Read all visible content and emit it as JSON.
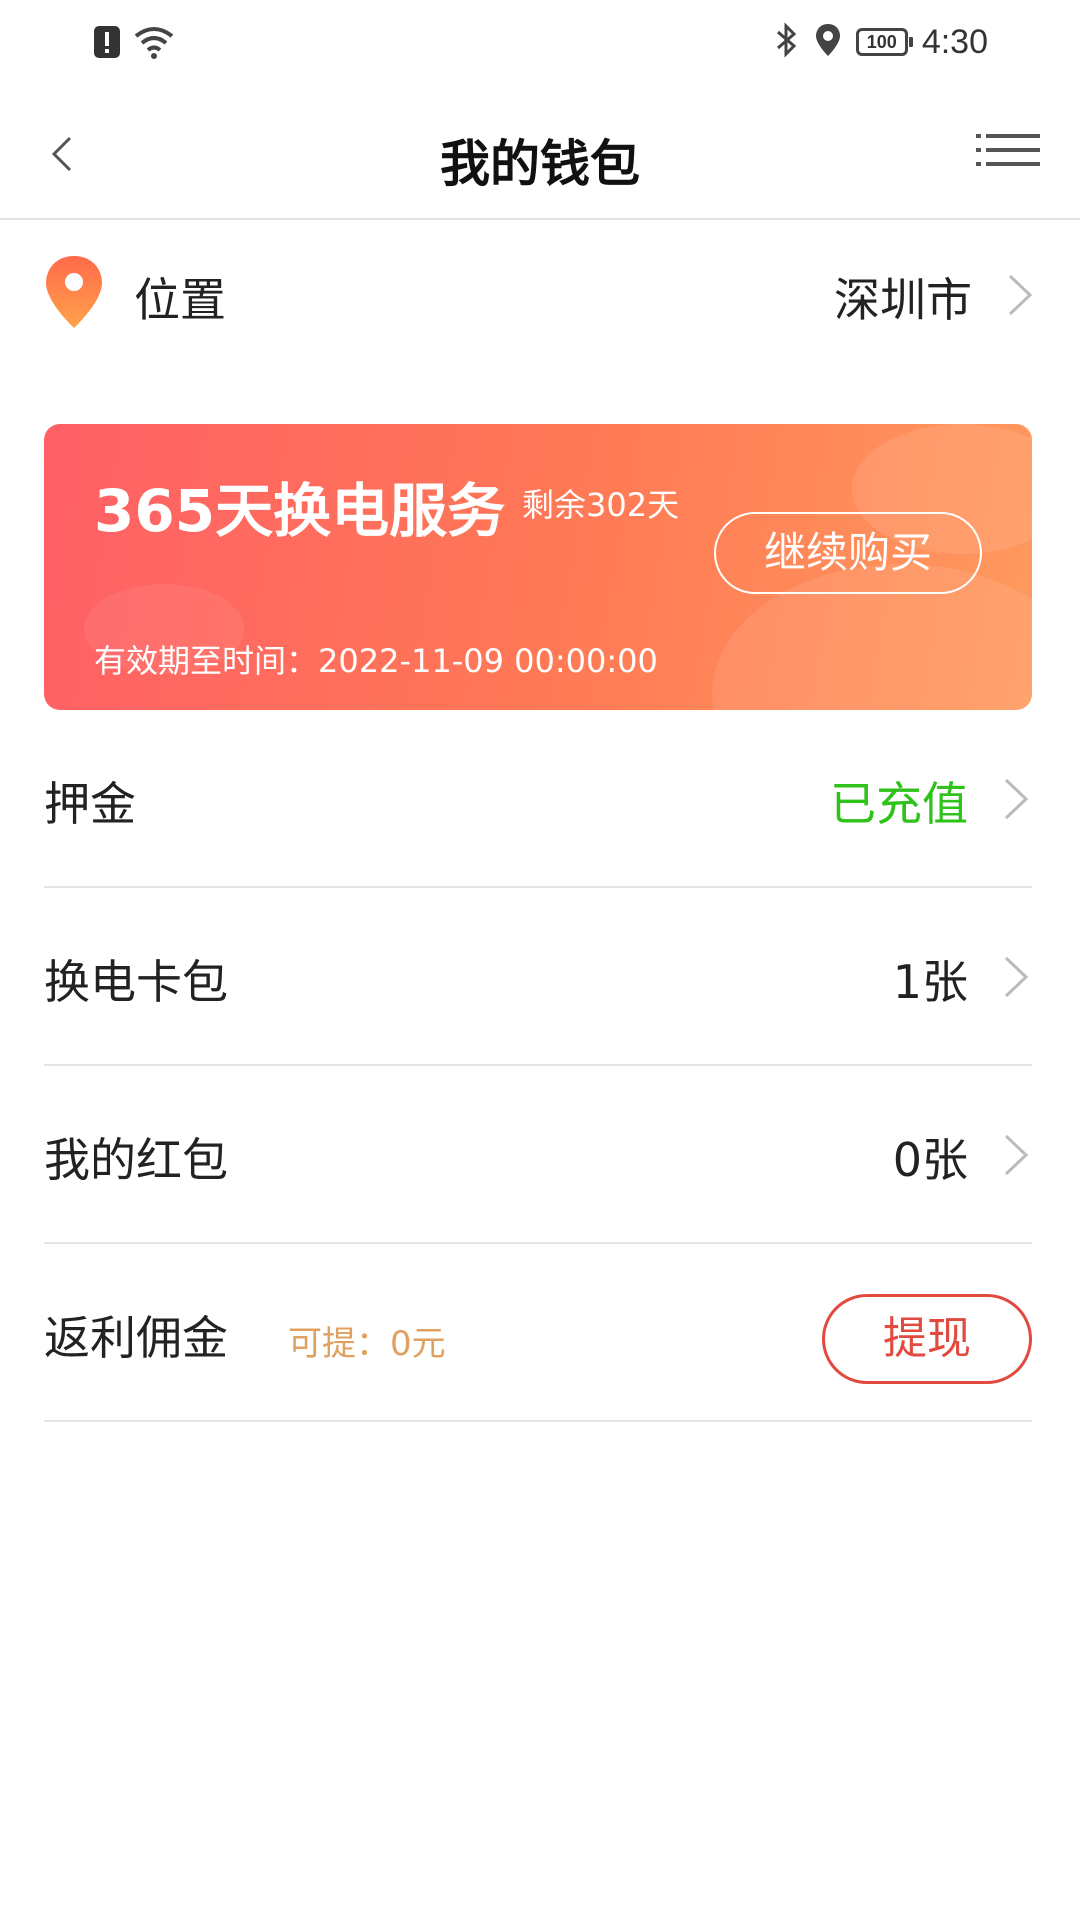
{
  "status_bar": {
    "time": "4:30",
    "battery": "100",
    "icons": [
      "alert-icon",
      "wifi-icon",
      "bluetooth-icon",
      "location-icon",
      "battery-icon"
    ]
  },
  "nav": {
    "title": "我的钱包",
    "back_icon": "chevron-left-icon",
    "menu_icon": "menu-icon"
  },
  "location": {
    "label": "位置",
    "value": "深圳市",
    "icon": "map-pin-icon"
  },
  "service_card": {
    "title": "365天换电服务",
    "remaining": "剩余302天",
    "button_label": "继续购买",
    "expiry": "有效期至时间：2022-11-09 00:00:00",
    "gradient_colors": [
      "#ff5f66",
      "#ff9a5e"
    ]
  },
  "rows": {
    "deposit": {
      "label": "押金",
      "value": "已充值",
      "value_color": "#2ec21a"
    },
    "swap_cards": {
      "label": "换电卡包",
      "value": "1张"
    },
    "red_packets": {
      "label": "我的红包",
      "value": "0张"
    },
    "commission": {
      "label": "返利佣金",
      "sub": "可提：0元",
      "button_label": "提现",
      "button_color": "#e2493f"
    }
  }
}
